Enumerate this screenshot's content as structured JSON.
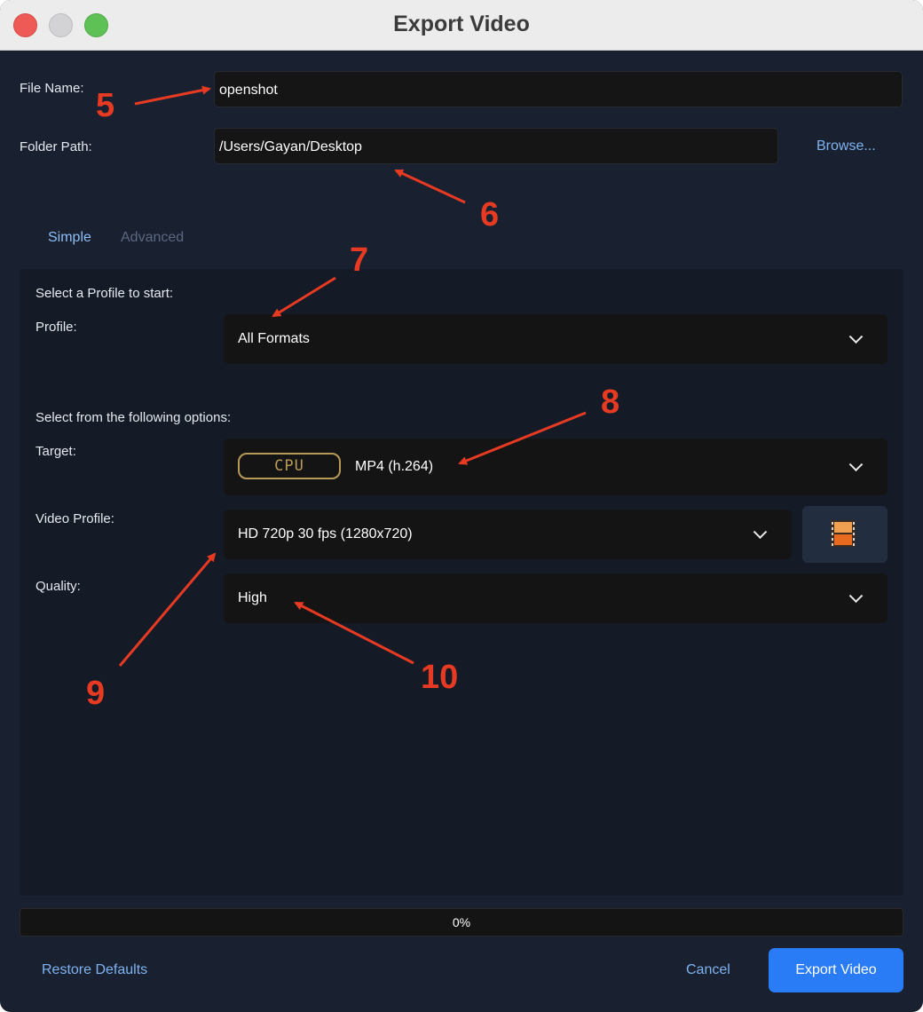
{
  "window": {
    "title": "Export Video"
  },
  "file": {
    "name_label": "File Name:",
    "name_value": "openshot",
    "folder_label": "Folder Path:",
    "folder_value": "/Users/Gayan/Desktop",
    "browse_label": "Browse..."
  },
  "tabs": [
    {
      "label": "Simple",
      "active": true
    },
    {
      "label": "Advanced",
      "active": false
    }
  ],
  "simple": {
    "profile_heading": "Select a Profile to start:",
    "profile_label": "Profile:",
    "profile_value": "All Formats",
    "options_heading": "Select from the following options:",
    "target_label": "Target:",
    "target_badge": "CPU",
    "target_value": "MP4 (h.264)",
    "video_profile_label": "Video Profile:",
    "video_profile_value": "HD 720p 30 fps (1280x720)",
    "video_profile_icon": "film-strip-icon",
    "quality_label": "Quality:",
    "quality_value": "High"
  },
  "progress": {
    "text": "0%",
    "fraction": 0
  },
  "footer": {
    "restore_label": "Restore Defaults",
    "cancel_label": "Cancel",
    "export_label": "Export Video"
  },
  "annotations": [
    "5",
    "6",
    "7",
    "8",
    "9",
    "10"
  ],
  "colors": {
    "background": "#192030",
    "panel": "#141a26",
    "accent": "#2a7cf6",
    "link": "#7fb3f0",
    "annotation": "#e63a22",
    "cpu_badge": "#b89a58"
  }
}
